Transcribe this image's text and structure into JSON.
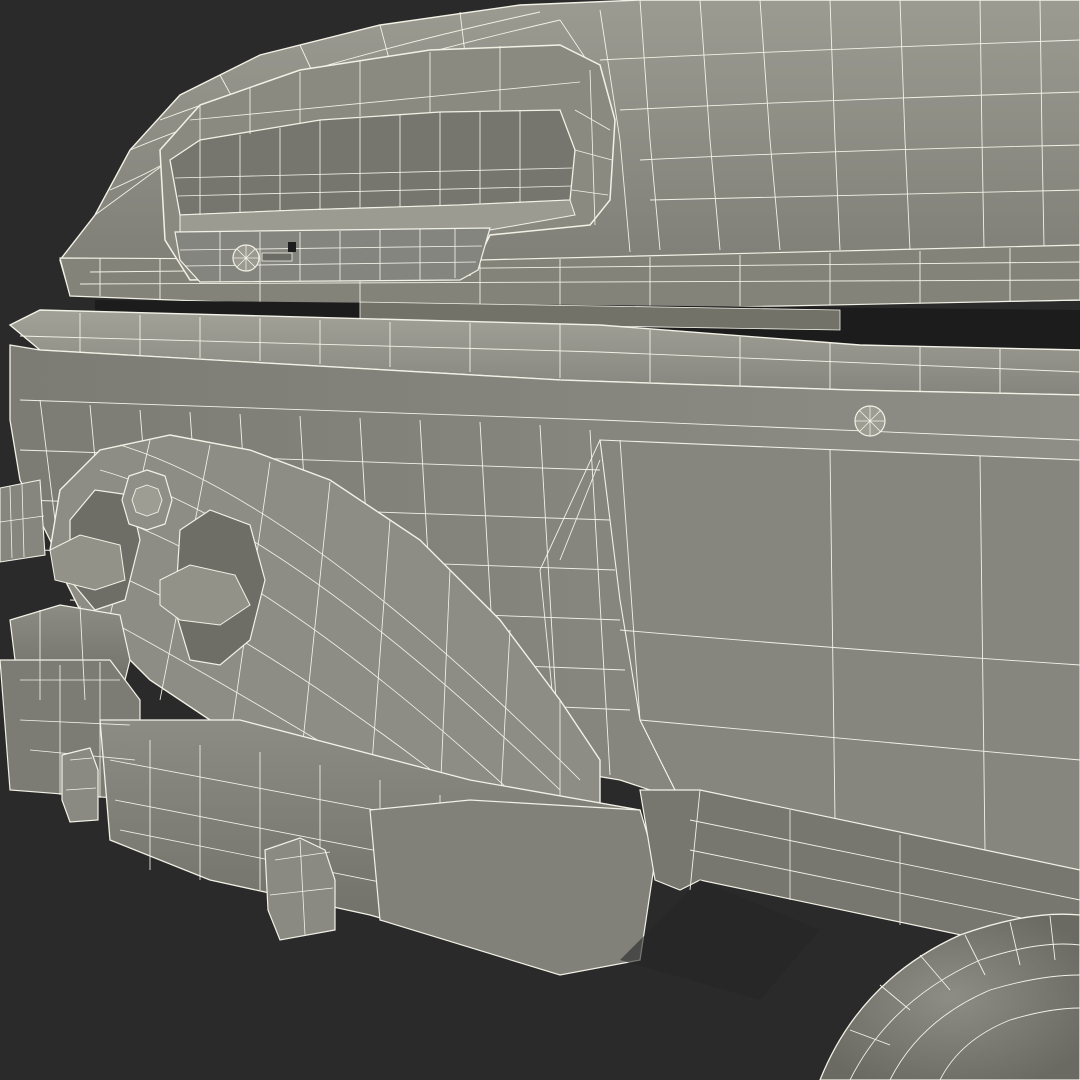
{
  "scene": {
    "subject": "wireframe-render",
    "colors": {
      "background": "#2a2a2b",
      "surface": "#8b8b82",
      "surface_light": "#9a9a91",
      "surface_dark": "#6f6f67",
      "wire": "#f2f1e6"
    }
  }
}
